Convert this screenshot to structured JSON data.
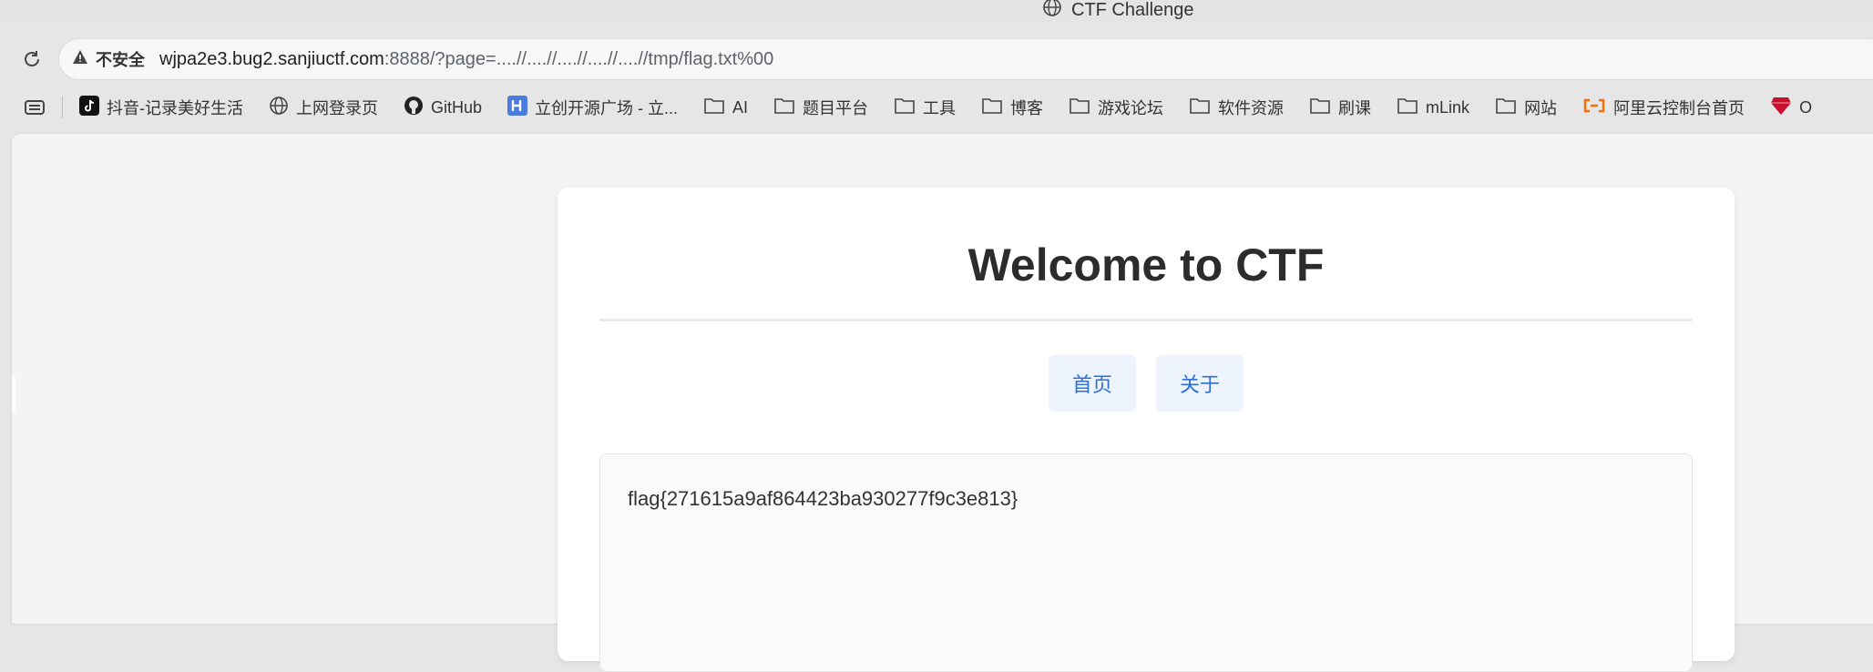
{
  "window": {
    "tab_title": "CTF Challenge"
  },
  "toolbar": {
    "security_label": "不安全",
    "url_host": "wjpa2e3.bug2.sanjiuctf.com",
    "url_rest": ":8888/?page=....//....//....//....//....//tmp/flag.txt%00"
  },
  "bookmarks": [
    {
      "label": "抖音-记录美好生活",
      "icon": "tiktok-icon"
    },
    {
      "label": "上网登录页",
      "icon": "globe-icon"
    },
    {
      "label": "GitHub",
      "icon": "github-icon"
    },
    {
      "label": "立创开源广场 - 立...",
      "icon": "lceda-icon"
    },
    {
      "label": "AI",
      "icon": "folder-icon"
    },
    {
      "label": "题目平台",
      "icon": "folder-icon"
    },
    {
      "label": "工具",
      "icon": "folder-icon"
    },
    {
      "label": "博客",
      "icon": "folder-icon"
    },
    {
      "label": "游戏论坛",
      "icon": "folder-icon"
    },
    {
      "label": "软件资源",
      "icon": "folder-icon"
    },
    {
      "label": "刷课",
      "icon": "folder-icon"
    },
    {
      "label": "mLink",
      "icon": "folder-icon"
    },
    {
      "label": "网站",
      "icon": "folder-icon"
    },
    {
      "label": "阿里云控制台首页",
      "icon": "aliyun-icon"
    },
    {
      "label": "O",
      "icon": "ruby-icon"
    }
  ],
  "page": {
    "heading": "Welcome to CTF",
    "nav": [
      {
        "label": "首页"
      },
      {
        "label": "关于"
      }
    ],
    "content": "flag{271615a9af864423ba930277f9c3e813}"
  },
  "colors": {
    "accent": "#2f6fd1",
    "nav_bg": "#edf4fd",
    "page_bg": "#f2f4f5"
  }
}
